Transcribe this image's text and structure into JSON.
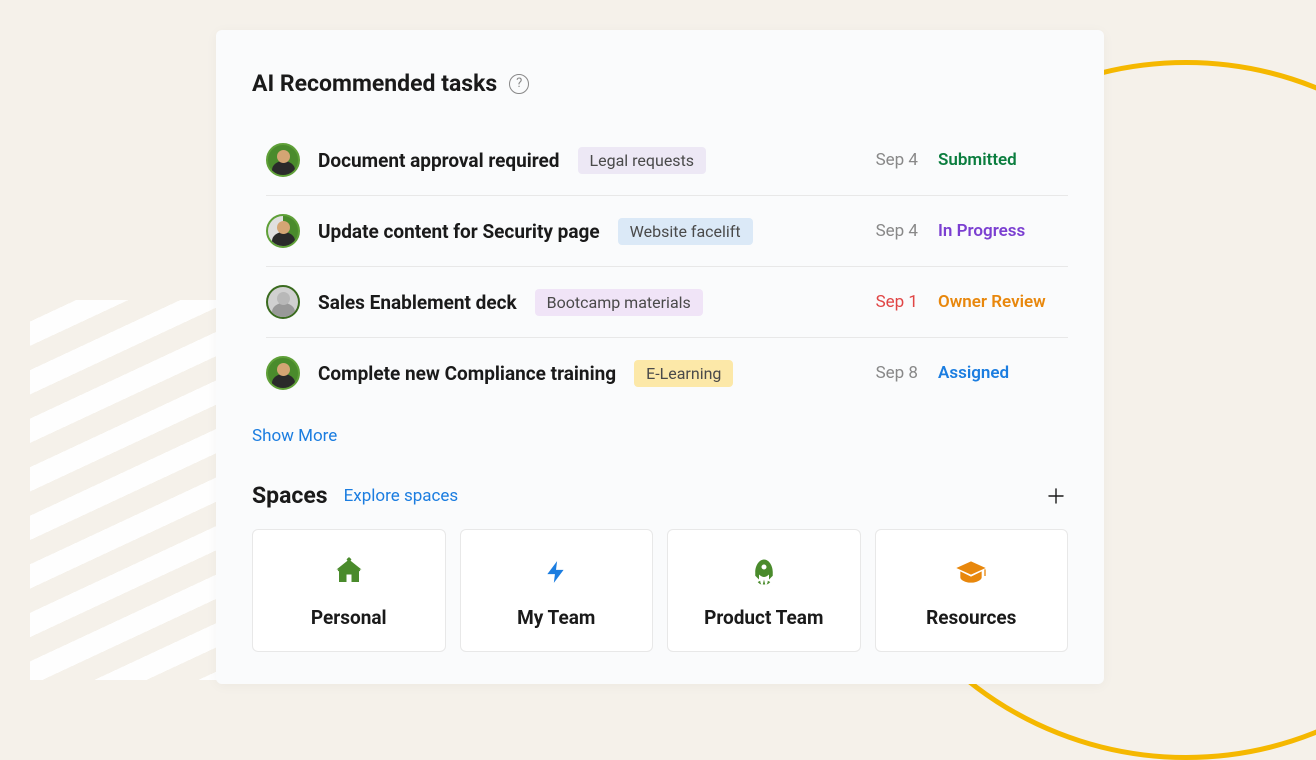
{
  "recommended": {
    "title": "AI Recommended tasks",
    "help_symbol": "?",
    "show_more_label": "Show More",
    "tasks": [
      {
        "title": "Document approval required",
        "tag": "Legal requests",
        "tag_class": "tag-purple",
        "date": "Sep 4",
        "date_red": false,
        "status": "Submitted",
        "status_class": "status-green",
        "avatar_class": ""
      },
      {
        "title": "Update content for Security page",
        "tag": "Website facelift",
        "tag_class": "tag-blue",
        "date": "Sep 4",
        "date_red": false,
        "status": "In Progress",
        "status_class": "status-purple",
        "avatar_class": "split"
      },
      {
        "title": "Sales Enablement deck",
        "tag": "Bootcamp materials",
        "tag_class": "tag-lilac",
        "date": "Sep 1",
        "date_red": true,
        "status": "Owner Review",
        "status_class": "status-orange",
        "avatar_class": "gray"
      },
      {
        "title": "Complete new Compliance training",
        "tag": "E-Learning",
        "tag_class": "tag-yellow",
        "date": "Sep 8",
        "date_red": false,
        "status": "Assigned",
        "status_class": "status-blue",
        "avatar_class": ""
      }
    ]
  },
  "spaces": {
    "title": "Spaces",
    "explore_label": "Explore spaces",
    "items": [
      {
        "label": "Personal",
        "icon": "house",
        "color": "#4a8b2c"
      },
      {
        "label": "My Team",
        "icon": "bolt",
        "color": "#1b7de0"
      },
      {
        "label": "Product Team",
        "icon": "rocket",
        "color": "#4a8b2c"
      },
      {
        "label": "Resources",
        "icon": "grad",
        "color": "#e8870c"
      }
    ]
  }
}
